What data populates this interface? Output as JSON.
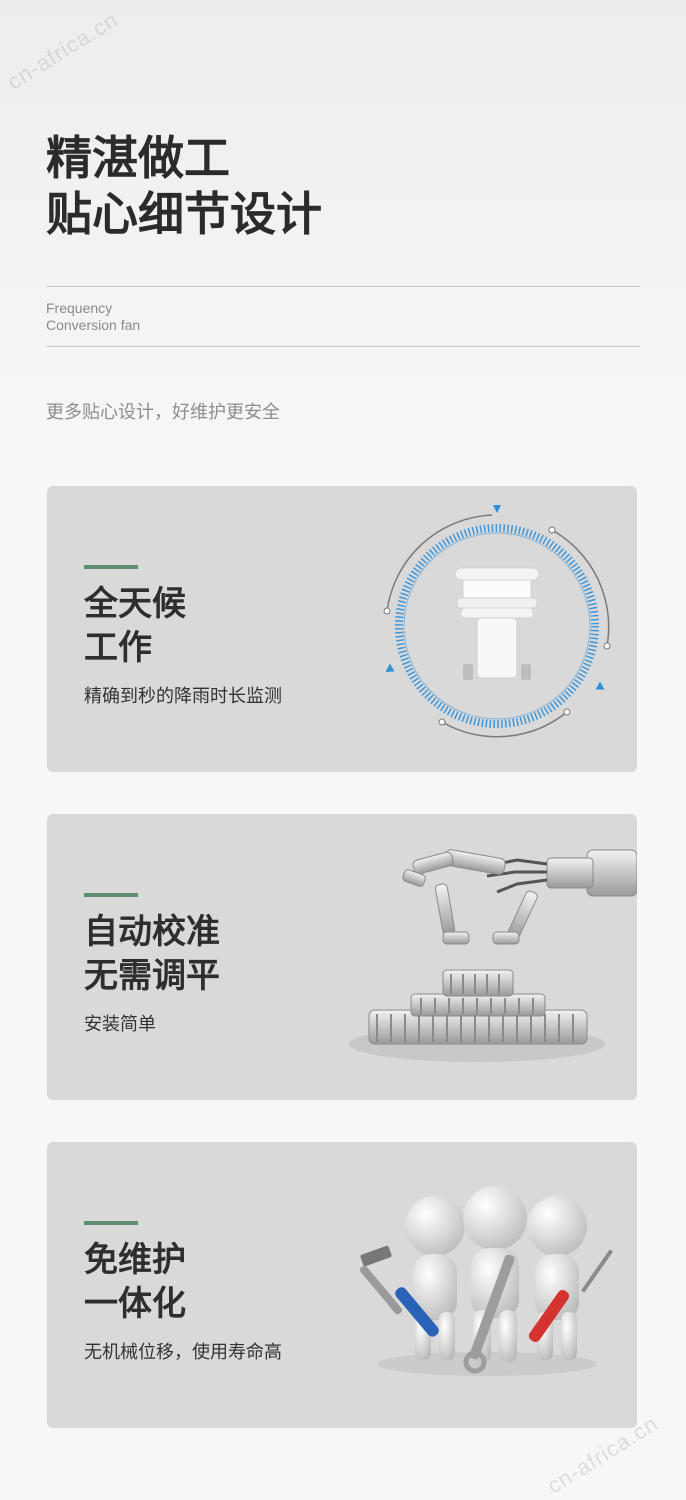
{
  "watermark": "cn-africa.cn",
  "headline": {
    "line1": "精湛做工",
    "line2": "贴心细节设计"
  },
  "subtitle_en": {
    "line1": "Frequency",
    "line2": "Conversion fan"
  },
  "tagline": "更多贴心设计，好维护更安全",
  "cards": [
    {
      "title_line1": "全天候",
      "title_line2": "工作",
      "desc": "精确到秒的降雨时长监测",
      "image": "weather-sensor-dial-icon"
    },
    {
      "title_line1": "自动校准",
      "title_line2": "无需调平",
      "desc": "安装简单",
      "image": "robot-arm-gears-icon"
    },
    {
      "title_line1": "免维护",
      "title_line2": "一体化",
      "desc": "无机械位移，使用寿命高",
      "image": "figures-with-tools-icon"
    }
  ],
  "colors": {
    "accent_bar": "#5e8f73",
    "card_bg": "#d9d9d9",
    "dial_blue": "#2f8fd8"
  }
}
